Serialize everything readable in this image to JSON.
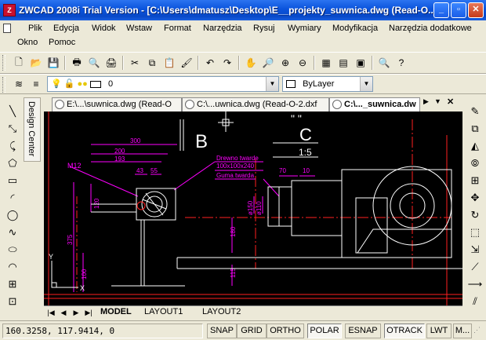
{
  "window": {
    "title": "ZWCAD 2008i Trial Version - [C:\\Users\\dmatusz\\Desktop\\E__projekty_suwnica.dwg (Read-O..."
  },
  "menu": [
    "Plik",
    "Edycja",
    "Widok",
    "Wstaw",
    "Format",
    "Narzędzia",
    "Rysuj",
    "Wymiary",
    "Modyfikacja",
    "Narzędzia dodatkowe",
    "Okno",
    "Pomoc"
  ],
  "properties": {
    "layer": "0",
    "linetype": "ByLayer"
  },
  "side_panel": {
    "label": "Design Center"
  },
  "doc_tabs": [
    "E:\\...\\suwnica.dwg (Read-O",
    "C:\\...uwnica.dwg (Read-O-2.dxf",
    "C:\\..._suwnica.dw"
  ],
  "drawing": {
    "view_b": "B",
    "view_c_quotes": "\" \"",
    "view_c": "C",
    "scale": "1:5",
    "note1": "Drewno twarde",
    "note2": "100x100x240",
    "note3": "Guma twarda",
    "thread": "M12",
    "dims": {
      "d300": "300",
      "d200": "200",
      "d193": "193",
      "d43": "43",
      "d55": "55",
      "d70": "70",
      "d10": "10",
      "d120": "120",
      "d375": "375",
      "d100": "100",
      "d180": "180",
      "d115": "115",
      "d150": "ø150",
      "d110": "ø110"
    },
    "ucs_y": "Y",
    "ucs_x": "X"
  },
  "layout_tabs": [
    "MODEL",
    "LAYOUT1",
    "LAYOUT2"
  ],
  "status": {
    "coords": "160.3258,  117.9414,  0",
    "buttons": [
      "SNAP",
      "GRID",
      "ORTHO",
      "POLAR",
      "ESNAP",
      "OTRACK",
      "LWT",
      "M..."
    ]
  },
  "colors": {
    "drawing_bg": "#000000",
    "magenta": "#ff00ff",
    "red": "#ff2020",
    "white": "#ffffff",
    "title_blue": "#0a53dc"
  }
}
